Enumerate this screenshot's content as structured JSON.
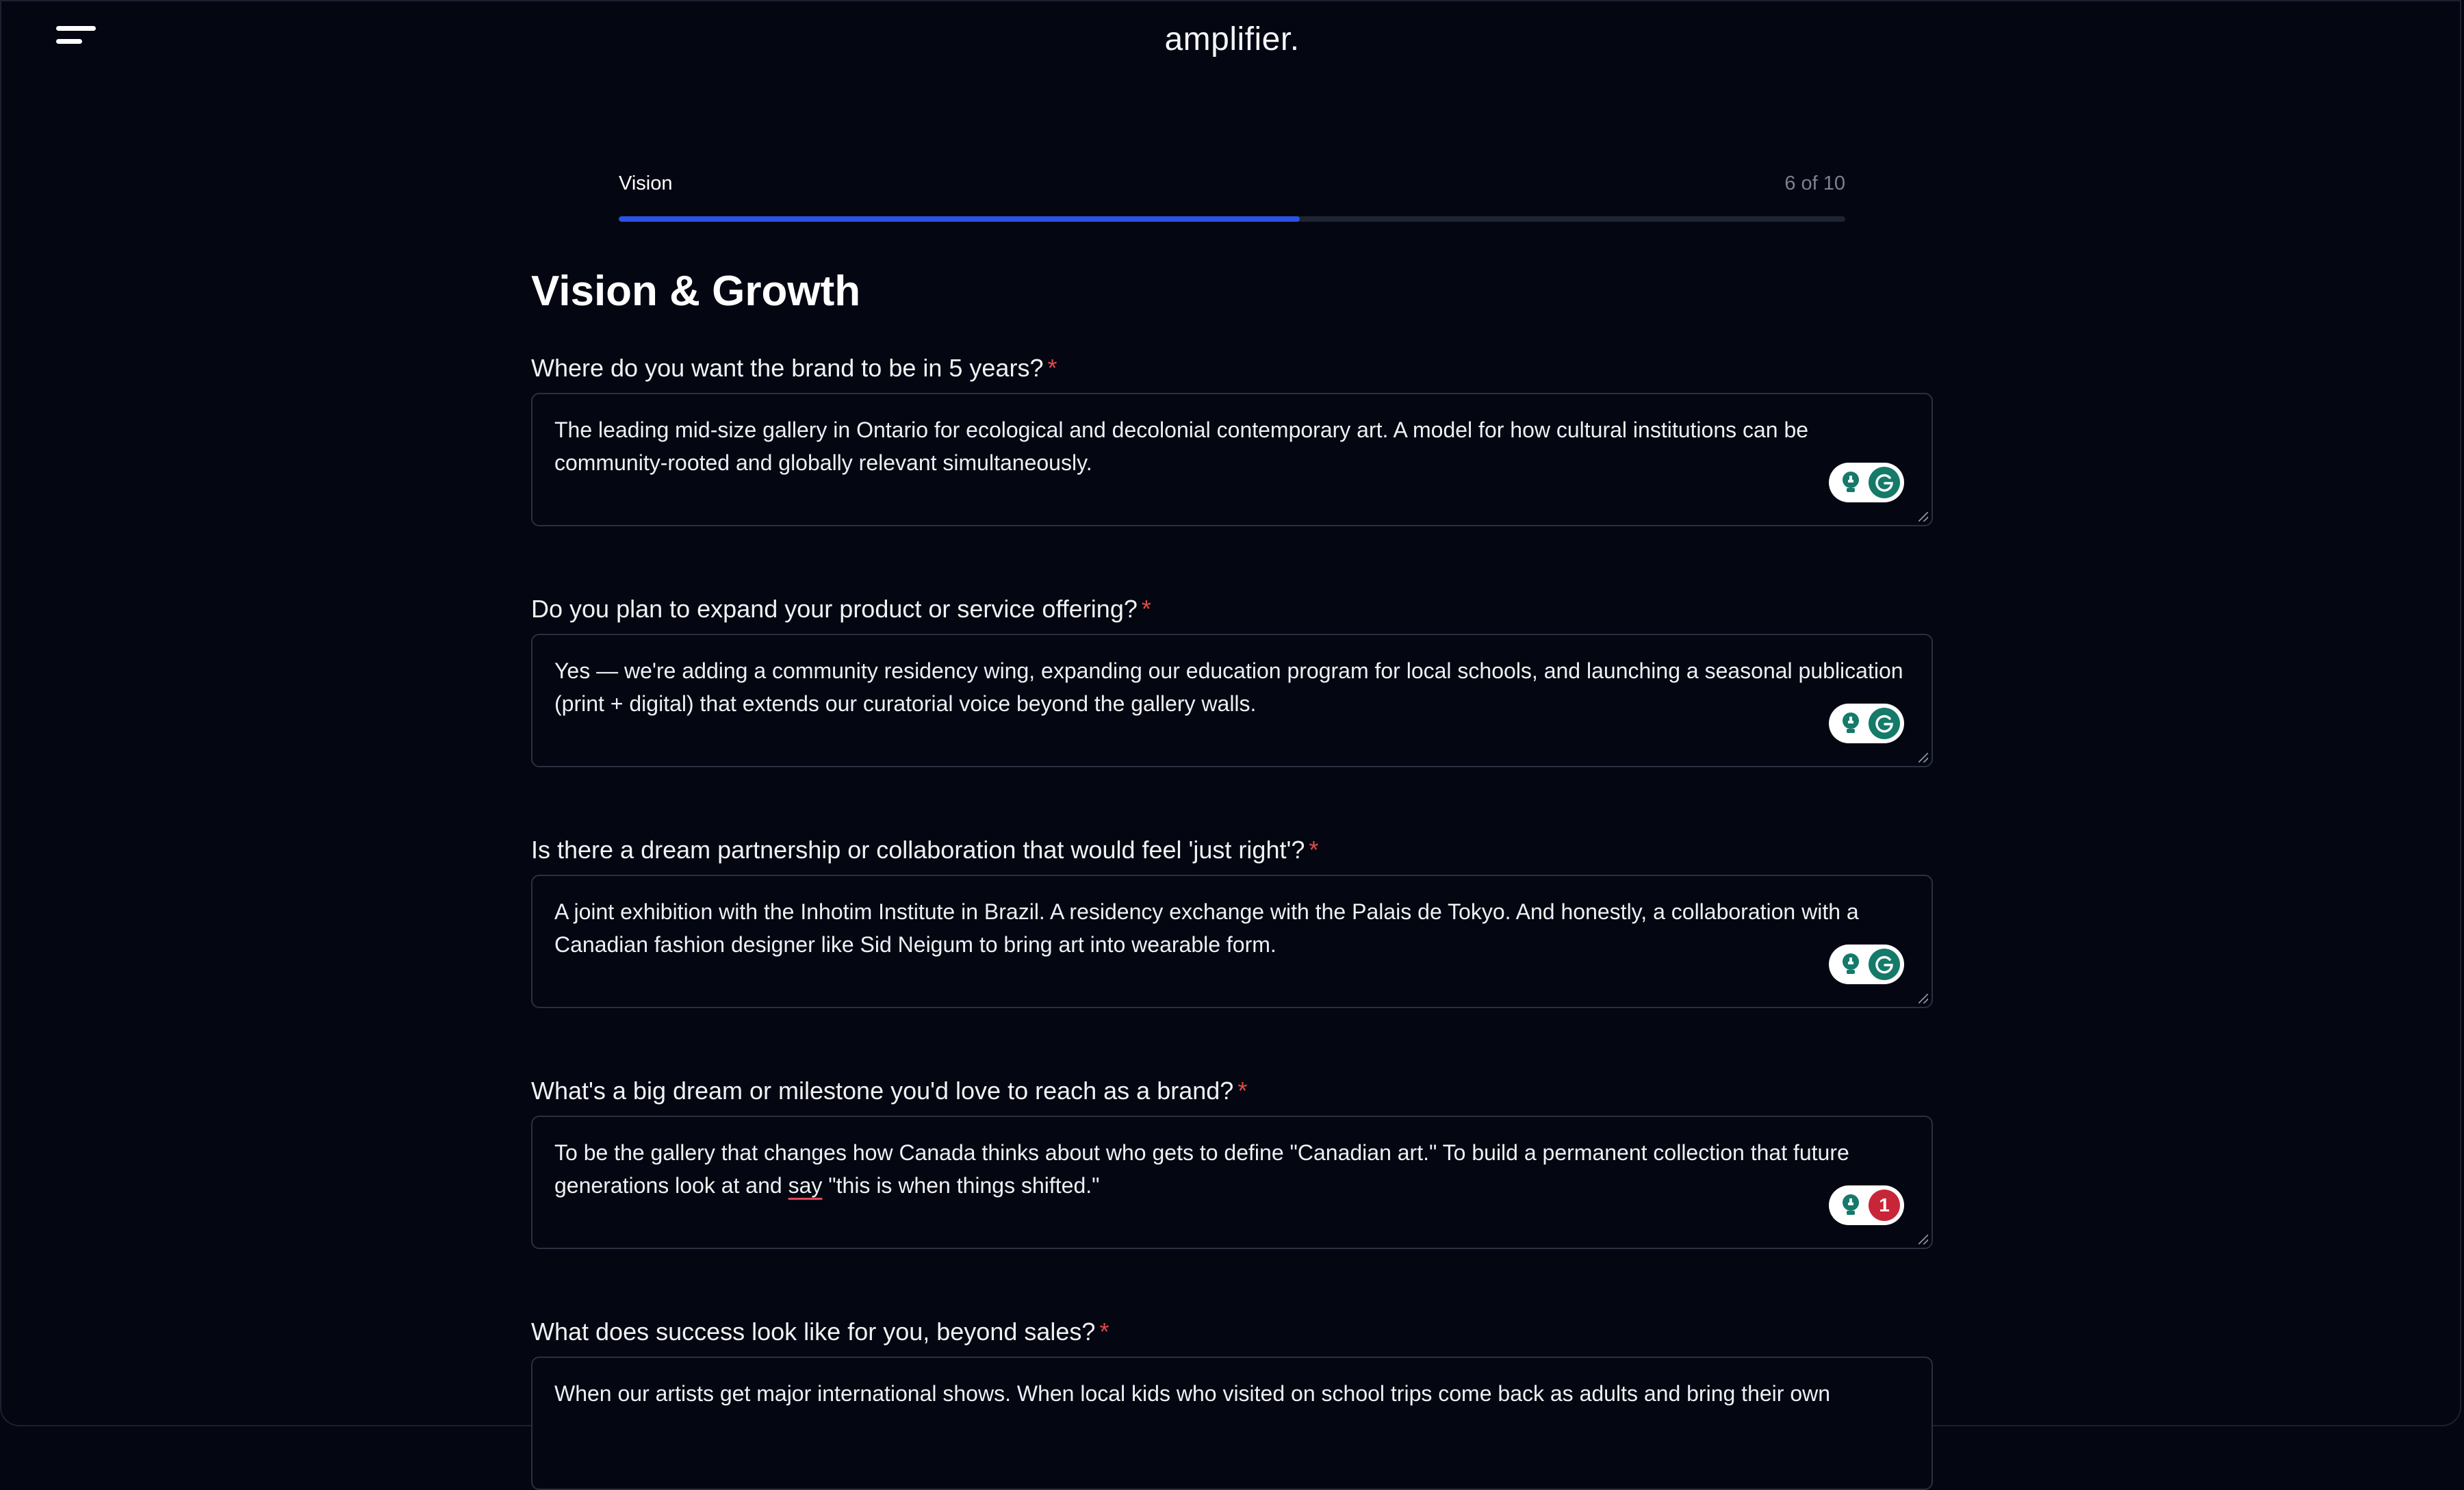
{
  "app": {
    "logo": "amplifier."
  },
  "progress": {
    "step_name": "Vision",
    "count": "6 of 10",
    "fraction": 0.555
  },
  "page": {
    "title": "Vision & Growth"
  },
  "questions": [
    {
      "label": "Where do you want the brand to be in 5 years?",
      "required": "*",
      "answer": "The leading mid-size gallery in Ontario for ecological and decolonial contemporary art. A model for how cultural institutions can be community-rooted and globally relevant simultaneously."
    },
    {
      "label": "Do you plan to expand your product or service offering?",
      "required": "*",
      "answer": "Yes — we're adding a community residency wing, expanding our education program for local schools, and launching a seasonal publication (print + digital) that extends our curatorial voice beyond the gallery walls."
    },
    {
      "label": "Is there a dream partnership or collaboration that would feel 'just right'?",
      "required": "*",
      "answer": "A joint exhibition with the Inhotim Institute in Brazil. A residency exchange with the Palais de Tokyo. And honestly, a collaboration with a Canadian fashion designer like Sid Neigum to bring art into wearable form."
    },
    {
      "label": "What's a big dream or milestone you'd love to reach as a brand?",
      "required": "*",
      "answer_before": "To be the gallery that changes how Canada thinks about who gets to define \"Canadian art.\" To build a permanent collection that future generations look at and ",
      "answer_flagged": "say",
      "answer_after": " \"this is when things shifted.\"",
      "issue_count": "1"
    },
    {
      "label": "What does success look like for you, beyond sales?",
      "required": "*",
      "answer": "When our artists get major international shows. When local kids who visited on school trips come back as adults and bring their own"
    }
  ],
  "colors": {
    "accent": "#2b52e6",
    "required": "#e14848",
    "grammar_green": "#157a6a",
    "issue_red": "#c92539"
  }
}
